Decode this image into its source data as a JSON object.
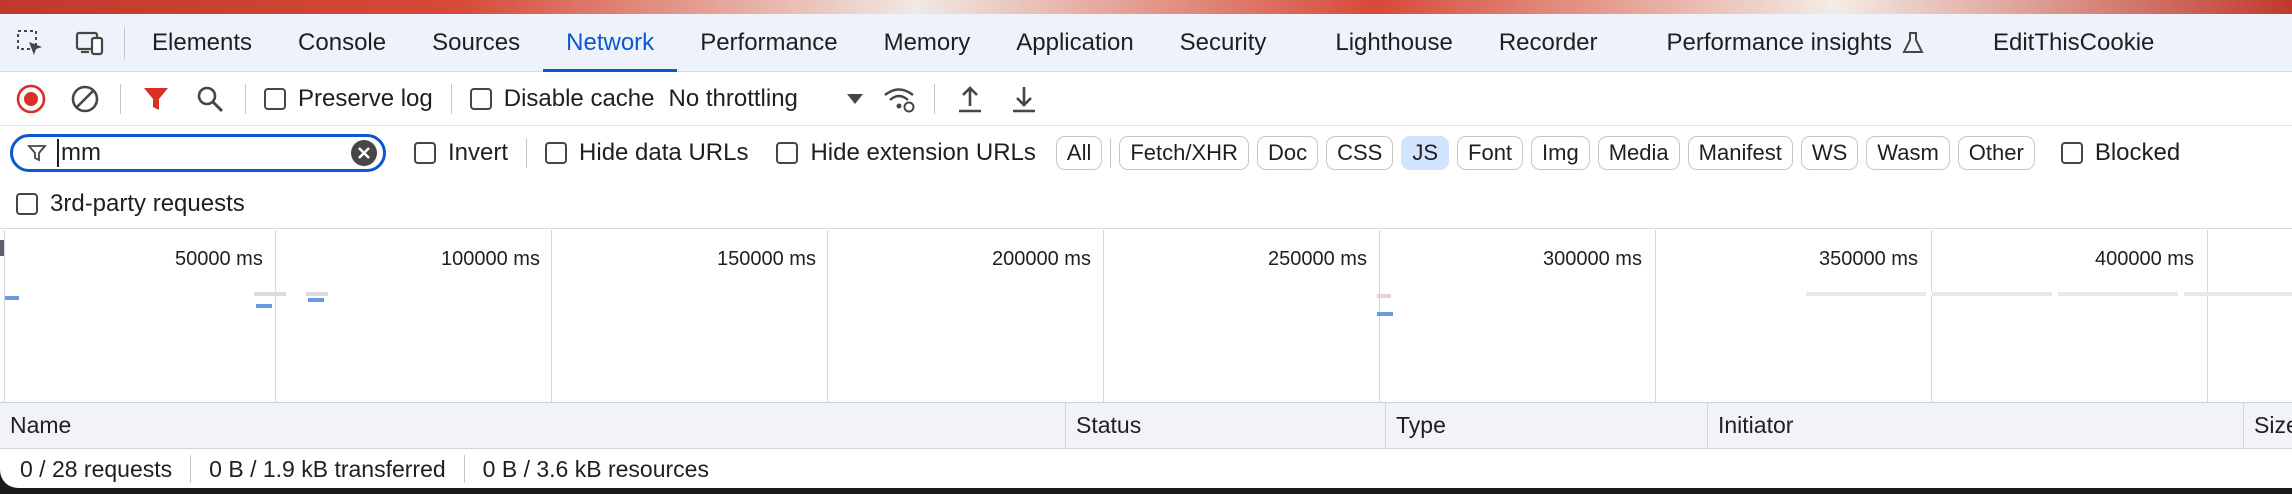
{
  "tabs": [
    {
      "label": "Elements",
      "active": false
    },
    {
      "label": "Console",
      "active": false
    },
    {
      "label": "Sources",
      "active": false
    },
    {
      "label": "Network",
      "active": true
    },
    {
      "label": "Performance",
      "active": false
    },
    {
      "label": "Memory",
      "active": false
    },
    {
      "label": "Application",
      "active": false
    },
    {
      "label": "Security",
      "active": false
    },
    {
      "label": "Lighthouse",
      "active": false
    },
    {
      "label": "Recorder",
      "active": false
    },
    {
      "label": "Performance insights",
      "active": false
    },
    {
      "label": "EditThisCookie",
      "active": false
    }
  ],
  "icons": {
    "inspect": "element-picker-icon",
    "device": "device-toolbar-icon",
    "record": "record-stop-icon",
    "clear": "clear-icon",
    "filter": "filter-icon",
    "search": "search-icon",
    "network_conditions": "network-conditions-icon",
    "import": "import-har-icon",
    "export": "export-har-icon",
    "experimental": "flask-icon"
  },
  "toolbar": {
    "preserve_log": {
      "label": "Preserve log",
      "checked": false
    },
    "disable_cache": {
      "label": "Disable cache",
      "checked": false
    },
    "throttling": "No throttling"
  },
  "filter": {
    "value": "mm",
    "invert": {
      "label": "Invert",
      "checked": false
    },
    "hide_data_urls": {
      "label": "Hide data URLs",
      "checked": false
    },
    "hide_extension_urls": {
      "label": "Hide extension URLs",
      "checked": false
    },
    "types": [
      {
        "label": "All",
        "active": false
      },
      {
        "label": "Fetch/XHR",
        "active": false
      },
      {
        "label": "Doc",
        "active": false
      },
      {
        "label": "CSS",
        "active": false
      },
      {
        "label": "JS",
        "active": true
      },
      {
        "label": "Font",
        "active": false
      },
      {
        "label": "Img",
        "active": false
      },
      {
        "label": "Media",
        "active": false
      },
      {
        "label": "Manifest",
        "active": false
      },
      {
        "label": "WS",
        "active": false
      },
      {
        "label": "Wasm",
        "active": false
      },
      {
        "label": "Other",
        "active": false
      }
    ],
    "blocked": {
      "label": "Blocked",
      "checked": false
    },
    "third_party": {
      "label": "3rd-party requests",
      "checked": false
    }
  },
  "overview": {
    "ticks": [
      "50000 ms",
      "100000 ms",
      "150000 ms",
      "200000 ms",
      "250000 ms",
      "300000 ms",
      "350000 ms",
      "400000 ms"
    ]
  },
  "table": {
    "columns": [
      "Name",
      "Status",
      "Type",
      "Initiator",
      "Size"
    ]
  },
  "status": {
    "requests": "0 / 28 requests",
    "transferred": "0 B / 1.9 kB transferred",
    "resources": "0 B / 3.6 kB resources"
  },
  "colors": {
    "accent": "#0b57d0",
    "record": "#d93025",
    "filter_active": "#d93025",
    "chip_active": "#d3e3fd"
  }
}
